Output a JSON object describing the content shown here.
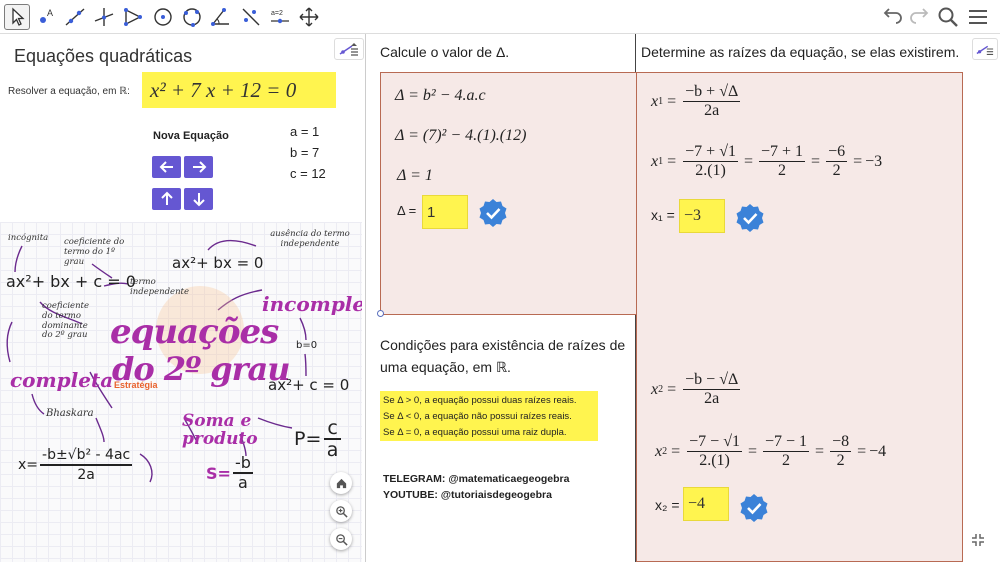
{
  "left": {
    "title": "Equações quadráticas",
    "resolve_label": "Resolver a equação, em ℝ:",
    "equation": "x² + 7 x + 12  = 0",
    "new_equation_label": "Nova Equação",
    "coef_a": "a = 1",
    "coef_b": "b = 7",
    "coef_c": "c = 12"
  },
  "poster": {
    "incognita": "incógnita",
    "coef_primeiro": "coeficiente do termo do 1º grau",
    "ausencia": "ausência do termo independente",
    "eq_general": "ax²+ bx + c = 0",
    "eq_bx": "ax²+ bx = 0",
    "termo_ind": "termo independente",
    "coef_dominante": "coeficiente do termo dominante do 2º grau",
    "incompleta": "incompleta",
    "equacoes": "equações",
    "do2grau": "do 2º grau",
    "b0": "b=0",
    "completa": "completa",
    "estrategia": "Estratégia",
    "eq_c": "ax²+ c = 0",
    "bhaskara": "Bhaskara",
    "soma": "Soma e produto",
    "p_lhs": "P=",
    "p_num": "c",
    "p_den": "a",
    "x_lhs": "x=",
    "x_num": "-b±√b² - 4ac",
    "x_den": "2a",
    "s_lhs": "S=",
    "s_num": "-b",
    "s_den": "a"
  },
  "middle": {
    "title": "Calcule o valor de Δ.",
    "formula1": "Δ = b² − 4.a.c",
    "formula2": "Δ = (7)² − 4.(1).(12)",
    "formula3": "Δ =  1",
    "delta_label": "Δ =",
    "delta_value": "1",
    "cond_title": "Condições para existência de raízes de uma equação, em ℝ.",
    "cond1": "Se Δ > 0, a equação possui duas raízes reais.",
    "cond2": "Se Δ < 0, a equação não possui raízes reais.",
    "cond3": "Se Δ = 0, a equação possui uma raiz dupla.",
    "telegram": "TELEGRAM: @matematicaegeogebra",
    "youtube": "YOUTUBE: @tutoriaisdegeogebra"
  },
  "right": {
    "title": "Determine as raízes da equação, se elas existirem.",
    "x1_formula_num": "−b + √Δ",
    "x1_formula_den": "2a",
    "x1_sub_num": "−7 + √1",
    "x1_sub_den": "2.(1)",
    "x1_step_num": "−7 + 1",
    "x1_step_den": "2",
    "x1_step2_num": "−6",
    "x1_step2_den": "2",
    "x1_result": "−3",
    "x1_label": "x₁ =",
    "x1_value": "−3",
    "x2_formula_num": "−b − √Δ",
    "x2_formula_den": "2a",
    "x2_sub_num": "−7  − √1",
    "x2_sub_den": "2.(1)",
    "x2_step_num": "−7 − 1",
    "x2_step_den": "2",
    "x2_step2_num": "−8",
    "x2_step2_den": "2",
    "x2_result": "−4",
    "x2_label": "x₂ =",
    "x2_value": "−4"
  },
  "colors": {
    "accent_purple": "#6557d2",
    "highlight_yellow": "#fff44f",
    "box_fill": "#f6e9e7",
    "box_border": "#b86a53",
    "check_blue": "#3b82d8"
  }
}
